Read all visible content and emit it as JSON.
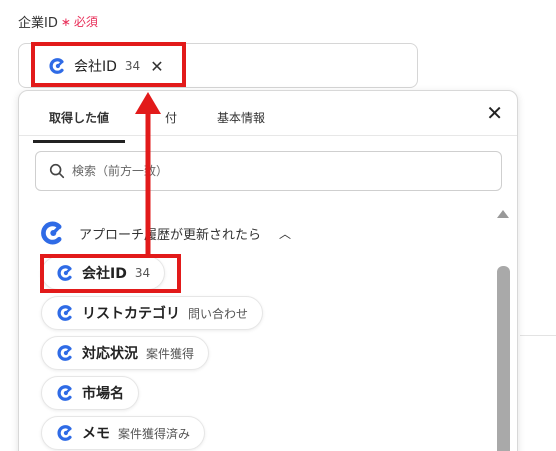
{
  "field": {
    "label": "企業ID",
    "required_mark": "∗",
    "required_text": "必須",
    "selected": {
      "name": "会社ID",
      "value": "34"
    }
  },
  "panel": {
    "tabs": [
      {
        "label": "取得した値",
        "active": true
      },
      {
        "label": "付",
        "active": false
      },
      {
        "label": "基本情報",
        "active": false
      }
    ],
    "search_placeholder": "検索（前方一致）",
    "group": {
      "title": "アプローチ履歴が更新されたら"
    },
    "items": [
      {
        "name": "会社ID",
        "value": "34"
      },
      {
        "name": "リストカテゴリ",
        "value": "問い合わせ"
      },
      {
        "name": "対応状況",
        "value": "案件獲得"
      },
      {
        "name": "市場名",
        "value": ""
      },
      {
        "name": "メモ",
        "value": "案件獲得済み"
      }
    ]
  },
  "colors": {
    "brand": "#2f6be6",
    "annotation": "#e21a1a",
    "required": "#e8305a"
  },
  "icons": [
    "app-logo-icon",
    "close-icon",
    "search-icon",
    "caret-up-icon",
    "scroll-up-icon"
  ]
}
